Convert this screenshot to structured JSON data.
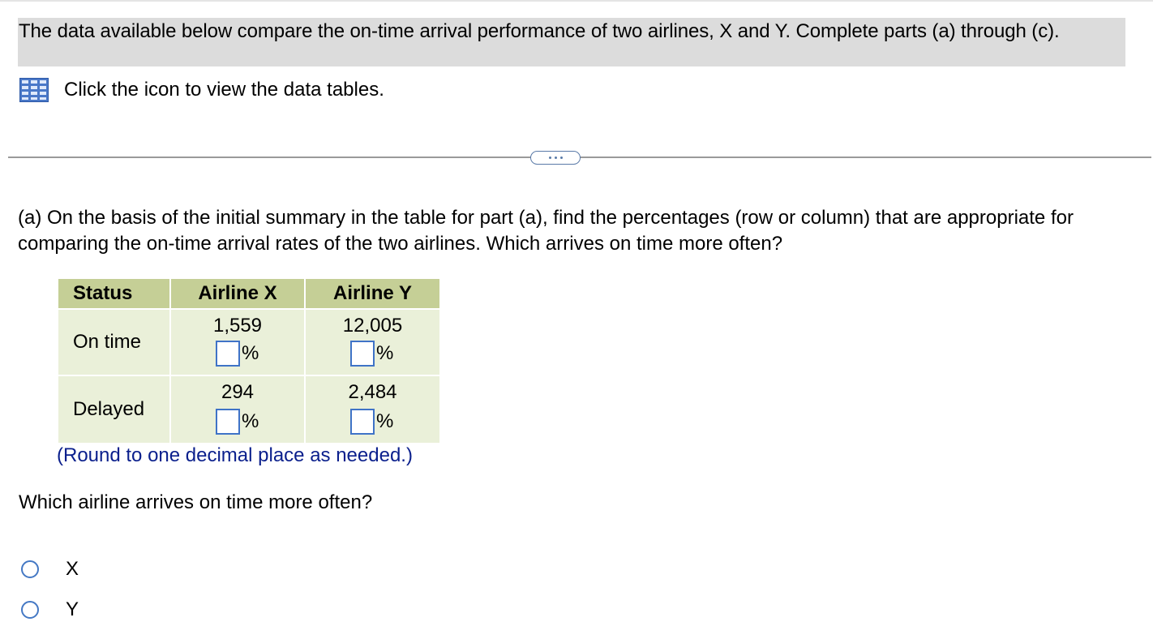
{
  "intro": {
    "text": "The data available below compare the on-time arrival performance of two airlines, X and Y. Complete parts (a) through (c).",
    "data_link": "Click the icon to view the data tables."
  },
  "part_a": {
    "question": "(a) On the basis of the initial summary in the table for part (a), find the percentages (row or column) that are appropriate for comparing the on-time arrival rates of the two airlines. Which arrives on time more often?"
  },
  "table": {
    "headers": [
      "Status",
      "Airline X",
      "Airline Y"
    ],
    "rows": [
      {
        "status": "On time",
        "x": "1,559",
        "y": "12,005"
      },
      {
        "status": "Delayed",
        "x": "294",
        "y": "2,484"
      }
    ],
    "percent_symbol": "%"
  },
  "round_note": "(Round to one decimal place as needed.)",
  "which_question": "Which airline arrives on time more often?",
  "options": [
    "X",
    "Y"
  ],
  "colors": {
    "header_bg": "#c5cf96",
    "body_bg": "#eaf0d9",
    "input_border": "#3f73c7",
    "note_text": "#0a1f8c",
    "radio_border": "#4478c4"
  },
  "icons": {
    "data_table": "table-grid-icon",
    "more": "ellipsis-icon"
  }
}
